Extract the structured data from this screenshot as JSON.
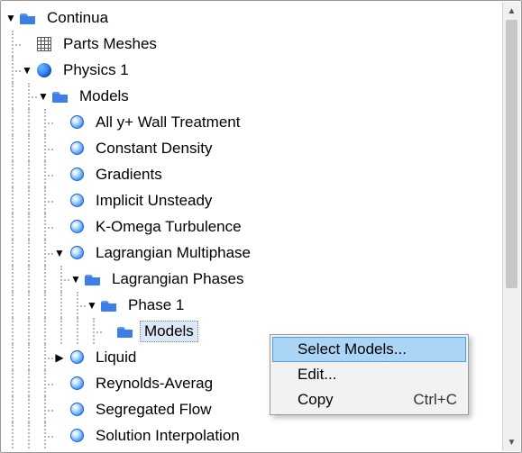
{
  "tree": {
    "continua": "Continua",
    "parts_meshes": "Parts Meshes",
    "physics1": "Physics 1",
    "models": "Models",
    "ally": "All y+ Wall Treatment",
    "const_density": "Constant Density",
    "gradients": "Gradients",
    "implicit_unsteady": "Implicit Unsteady",
    "komega": "K-Omega Turbulence",
    "lagrangian_mp": "Lagrangian Multiphase",
    "lagrangian_phases": "Lagrangian Phases",
    "phase1": "Phase 1",
    "phase1_models": "Models",
    "liquid": "Liquid",
    "reynolds_avg": "Reynolds-Averag",
    "segregated": "Segregated Flow",
    "solution_interp": "Solution Interpolation"
  },
  "menu": {
    "select_models": "Select Models...",
    "edit": "Edit...",
    "copy": "Copy",
    "copy_shortcut": "Ctrl+C"
  }
}
